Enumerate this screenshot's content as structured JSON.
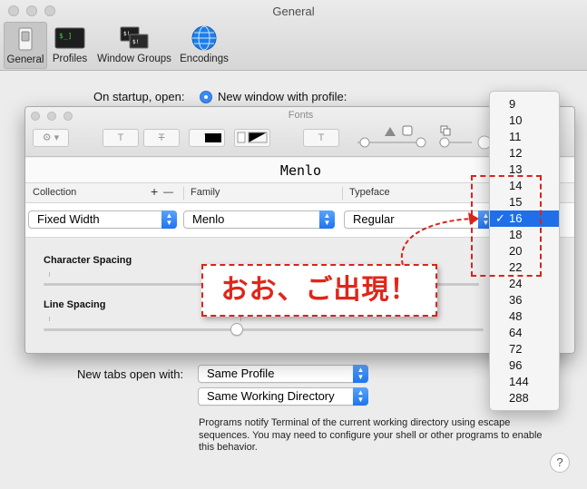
{
  "window": {
    "title": "General"
  },
  "toolbar": [
    {
      "label": "General",
      "icon": "switch-icon"
    },
    {
      "label": "Profiles",
      "icon": "terminal-icon"
    },
    {
      "label": "Window Groups",
      "icon": "window-groups-icon"
    },
    {
      "label": "Encodings",
      "icon": "globe-icon"
    }
  ],
  "startup": {
    "label": "On startup, open:",
    "option": "New window with profile:"
  },
  "new_tabs": {
    "label": "New tabs open with:",
    "profile_value": "Same Profile",
    "directory_value": "Same Working Directory"
  },
  "description": "Programs notify Terminal of the current working directory using escape sequences. You may need to configure your shell or other programs to enable this behavior.",
  "help_label": "?",
  "fonts_panel": {
    "title": "Fonts",
    "sample": "Menlo",
    "columns": {
      "collection": "Collection",
      "plus": "+",
      "minus": "—",
      "family": "Family",
      "typeface": "Typeface"
    },
    "collection_value": "Fixed Width",
    "family_value": "Menlo",
    "typeface_value": "Regular",
    "tool_glyphs": {
      "text": "T",
      "strike": "T",
      "doc": "T"
    },
    "character_spacing_label": "Character Spacing",
    "line_spacing_label": "Line Spacing",
    "line_spacing_level": 0.44
  },
  "size_menu": {
    "items": [
      "9",
      "10",
      "11",
      "12",
      "13",
      "14",
      "15",
      "16",
      "18",
      "20",
      "22",
      "24",
      "36",
      "48",
      "64",
      "72",
      "96",
      "144",
      "288"
    ],
    "selected": "16",
    "check": "✓"
  },
  "annotation": {
    "text": "おお、ご出現！"
  },
  "colors": {
    "accent": "#1f6fe8",
    "annotation_red": "#d8241b"
  }
}
